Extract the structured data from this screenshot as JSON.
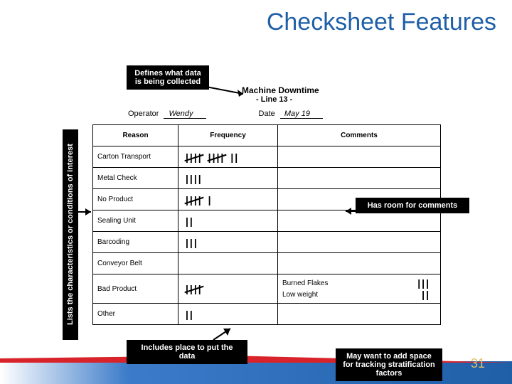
{
  "title": "Checksheet Features",
  "notes": {
    "defines": "Defines what data is being collected",
    "lists": "Lists the characteristics or conditions of interest",
    "includes": "Includes place to put the data",
    "room": "Has room for comments",
    "bottom": "May want to add space for tracking stratification factors"
  },
  "sheet": {
    "title": "Machine Downtime",
    "subtitle": "- Line 13 -",
    "operator_label": "Operator",
    "operator_value": "Wendy",
    "date_label": "Date",
    "date_value": "May 19",
    "headers": {
      "reason": "Reason",
      "frequency": "Frequency",
      "comments": "Comments"
    },
    "rows": [
      {
        "reason": "Carton Transport",
        "tally": [
          5,
          5,
          2
        ],
        "comment": ""
      },
      {
        "reason": "Metal Check",
        "tally": [
          4
        ],
        "comment": ""
      },
      {
        "reason": "No Product",
        "tally": [
          5,
          1
        ],
        "comment": ""
      },
      {
        "reason": "Sealing Unit",
        "tally": [
          2
        ],
        "comment": ""
      },
      {
        "reason": "Barcoding",
        "tally": [
          3
        ],
        "comment": ""
      },
      {
        "reason": "Conveyor Belt",
        "tally": [],
        "comment": ""
      },
      {
        "reason": "Bad Product",
        "tally": [
          5
        ],
        "comment_lines": [
          {
            "text": "Burned Flakes",
            "tally": [
              3
            ]
          },
          {
            "text": "Low weight",
            "tally": [
              2
            ]
          }
        ]
      },
      {
        "reason": "Other",
        "tally": [
          2
        ],
        "comment": ""
      }
    ]
  },
  "page_number": "31"
}
